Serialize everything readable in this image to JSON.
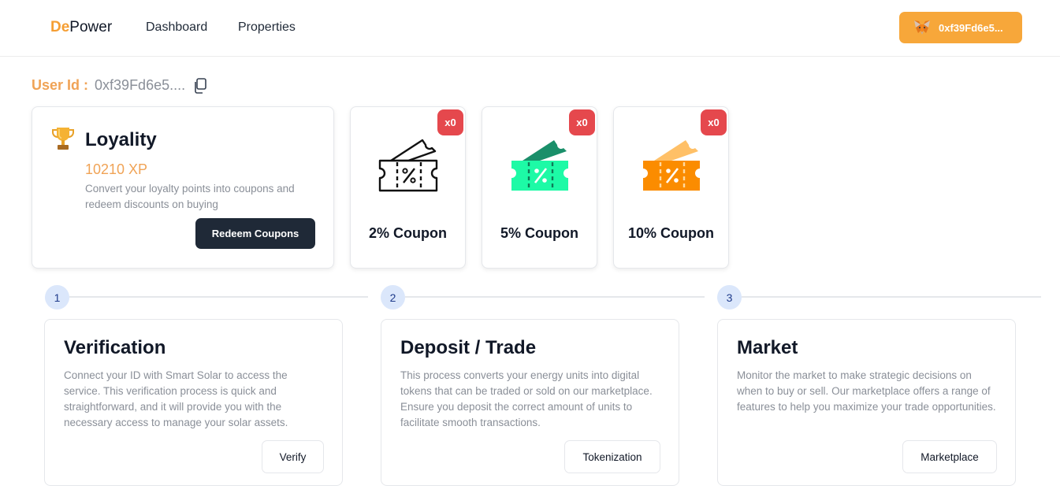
{
  "header": {
    "logo_prefix": "De",
    "logo_suffix": "Power",
    "nav": [
      "Dashboard",
      "Properties"
    ],
    "wallet_label": "0xf39Fd6e5...",
    "wallet_icon": "metamask-fox-icon",
    "wallet_color": "#f7a73a"
  },
  "user": {
    "label": "User Id :",
    "value": "0xf39Fd6e5....",
    "copy_icon": "copy-icon"
  },
  "loyalty": {
    "icon": "trophy-icon",
    "title": "Loyality",
    "xp": "10210 XP",
    "description": "Convert your loyalty points into coupons and redeem discounts on buying",
    "button": "Redeem Coupons"
  },
  "coupons": [
    {
      "label": "2% Coupon",
      "count": "x0",
      "color": "#111111",
      "icon": "ticket-outline-icon"
    },
    {
      "label": "5% Coupon",
      "count": "x0",
      "color": "#1dfaa6",
      "icon": "ticket-green-icon"
    },
    {
      "label": "10% Coupon",
      "count": "x0",
      "color": "#fb8c00",
      "icon": "ticket-orange-icon"
    }
  ],
  "steps": [
    {
      "number": "1",
      "title": "Verification",
      "description": "Connect your ID with Smart Solar to access the service. This verification process is quick and straightforward, and it will provide you with the necessary access to manage your solar assets.",
      "button": "Verify"
    },
    {
      "number": "2",
      "title": "Deposit / Trade",
      "description": "This process converts your energy units into digital tokens that can be traded or sold on our marketplace. Ensure you deposit the correct amount of units to facilitate smooth transactions.",
      "button": "Tokenization"
    },
    {
      "number": "3",
      "title": "Market",
      "description": "Monitor the market to make strategic decisions on when to buy or sell. Our marketplace offers a range of features to help you maximize your trade opportunities.",
      "button": "Marketplace"
    }
  ],
  "colors": {
    "accent": "#f0a356",
    "badge": "#e5484d",
    "dark_button": "#1f2937",
    "step_circle": "#dbe7fb"
  }
}
